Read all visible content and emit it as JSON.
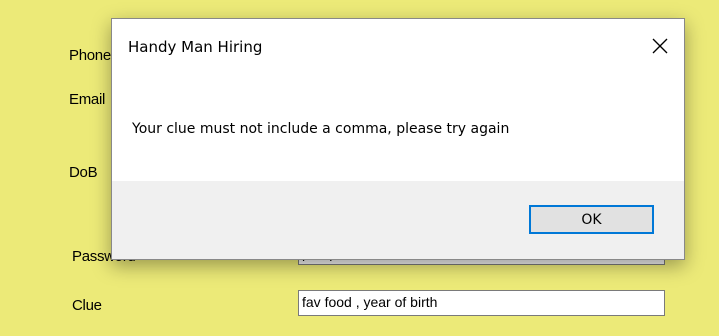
{
  "form": {
    "phone_label": "Phone",
    "email_label": "Email",
    "dob_label": "DoB",
    "password_label": "Password",
    "clue_label": "Clue",
    "password_value": "pumpkin32",
    "clue_value": "fav food , year of birth"
  },
  "dialog": {
    "title": "Handy Man Hiring",
    "message": "Your clue must not include a comma, please try again",
    "ok_label": "OK",
    "close_icon": "close-icon"
  },
  "colors": {
    "form_background": "#ecea78",
    "button_focus_border": "#0078d7"
  }
}
